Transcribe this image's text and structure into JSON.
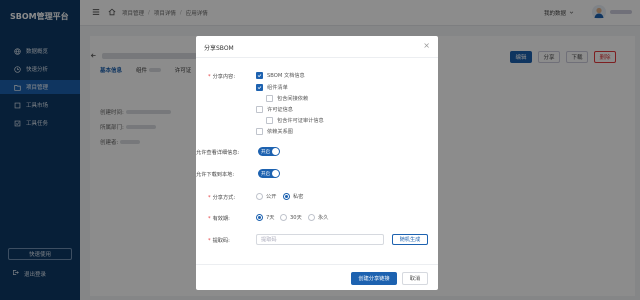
{
  "sidebar": {
    "brand": "SBOM管理平台",
    "items": [
      {
        "label": "数据概览",
        "icon": "globe-icon"
      },
      {
        "label": "快速分析",
        "icon": "clock-icon"
      },
      {
        "label": "项目管理",
        "icon": "folder-icon"
      },
      {
        "label": "工具市场",
        "icon": "box-icon"
      },
      {
        "label": "工具任务",
        "icon": "task-icon"
      }
    ],
    "quick_use": "快速使用",
    "logout": "退出登录"
  },
  "header": {
    "breadcrumbs": [
      "项目管理",
      "项目详情",
      "应用详情"
    ],
    "project_select": "我的数据"
  },
  "page": {
    "tabs": [
      "基本信息",
      "组件",
      "许可证"
    ],
    "fields": [
      "创建时间:",
      "所属部门:",
      "创建者:"
    ],
    "actions": {
      "edit": "编辑",
      "share": "分享",
      "download": "下载",
      "delete": "删除"
    }
  },
  "dialog": {
    "title": "分享SBOM",
    "content_label": "分享内容:",
    "options": [
      {
        "label": "SBOM 文档信息",
        "checked": true
      },
      {
        "label": "组件清单",
        "checked": true
      },
      {
        "label": "包含间接依赖",
        "checked": false
      },
      {
        "label": "许可证信息",
        "checked": false
      },
      {
        "label": "包含许可证审计信息",
        "checked": false
      },
      {
        "label": "依赖关系图",
        "checked": false
      }
    ],
    "view_detail_label": "允许查看详细信息:",
    "download_label": "允许下载到本地:",
    "switch_on": "开启",
    "share_mode_label": "分享方式:",
    "share_modes": [
      {
        "label": "公开",
        "selected": false
      },
      {
        "label": "私密",
        "selected": true
      }
    ],
    "validity_label": "有效期:",
    "validity": [
      {
        "label": "7天",
        "selected": true
      },
      {
        "label": "30天",
        "selected": false
      },
      {
        "label": "永久",
        "selected": false
      }
    ],
    "code_label": "提取码:",
    "code_placeholder": "提取码",
    "generate": "随机生成",
    "create": "创建分享链接",
    "cancel": "取消"
  },
  "colors": {
    "sidebar": "#0d3a66",
    "primary": "#1d62b0",
    "danger": "#e4393c"
  }
}
